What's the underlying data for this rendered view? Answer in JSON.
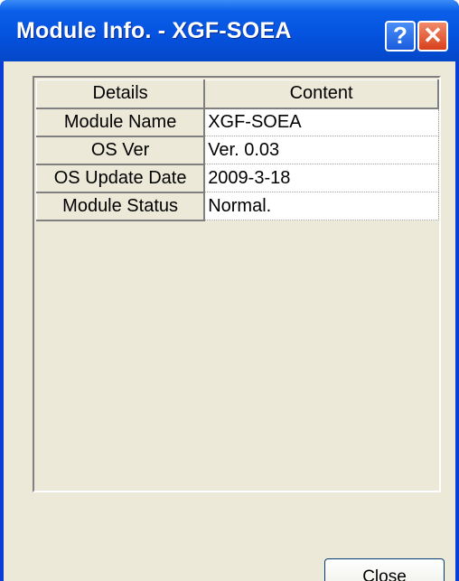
{
  "window": {
    "title": "Module Info. - XGF-SOEA",
    "help_glyph": "?",
    "close_glyph": "✕"
  },
  "table": {
    "headers": [
      "Details",
      "Content"
    ],
    "rows": [
      {
        "label": "Module Name",
        "value": "XGF-SOEA"
      },
      {
        "label": "OS Ver",
        "value": "Ver.  0.03"
      },
      {
        "label": "OS Update Date",
        "value": "2009-3-18"
      },
      {
        "label": "Module Status",
        "value": "Normal."
      }
    ]
  },
  "buttons": {
    "close_label": "Close"
  },
  "colors": {
    "titlebar": "#0553e0",
    "client_bg": "#ece9d8",
    "close_button": "#d8401c"
  }
}
